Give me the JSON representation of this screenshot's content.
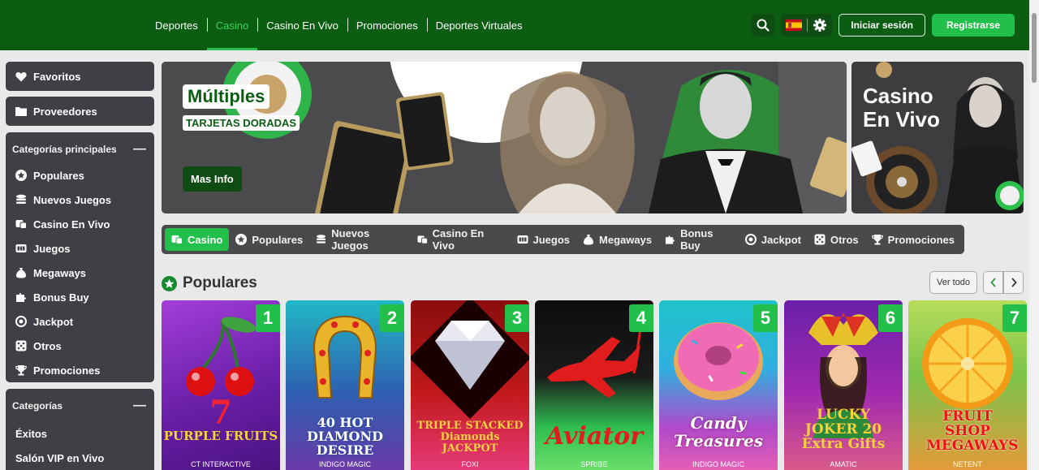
{
  "header": {
    "nav": [
      "Deportes",
      "Casino",
      "Casino En Vivo",
      "Promociones",
      "Deportes Virtuales"
    ],
    "active_nav": "Casino",
    "login_label": "Iniciar sesión",
    "register_label": "Registrarse"
  },
  "sidebar": {
    "favorites_label": "Favoritos",
    "providers_label": "Proveedores",
    "main_categories_title": "Categorías principales",
    "main_categories": [
      "Populares",
      "Nuevos Juegos",
      "Casino En Vivo",
      "Juegos",
      "Megaways",
      "Bonus Buy",
      "Jackpot",
      "Otros",
      "Promociones"
    ],
    "categories_title": "Categorías",
    "categories": [
      "Éxitos",
      "Salón VIP en Vivo"
    ]
  },
  "banner": {
    "title": "Múltiples",
    "subtitle": "TARJETAS DORADAS",
    "cta": "Mas Info",
    "side_title_1": "Casino",
    "side_title_2": "En Vivo"
  },
  "category_bar": [
    "Casino",
    "Populares",
    "Nuevos Juegos",
    "Casino En Vivo",
    "Juegos",
    "Megaways",
    "Bonus Buy",
    "Jackpot",
    "Otros",
    "Promociones"
  ],
  "section": {
    "title": "Populares",
    "view_all": "Ver todo"
  },
  "games": [
    {
      "rank": "1",
      "name": "PURPLE FRUITS",
      "provider": "CT INTERACTIVE"
    },
    {
      "rank": "2",
      "name": "40 HOT DIAMOND DESIRE",
      "provider": "INDIGO MAGIC"
    },
    {
      "rank": "3",
      "name": "TRIPLE STACKED Diamonds JACKPOT",
      "provider": "FOXI"
    },
    {
      "rank": "4",
      "name": "Aviator",
      "provider": "SPRIBE"
    },
    {
      "rank": "5",
      "name": "Candy Treasures",
      "provider": "INDIGO MAGIC"
    },
    {
      "rank": "6",
      "name": "LUCKY JOKER 20 Extra Gifts",
      "provider": "AMATIC"
    },
    {
      "rank": "7",
      "name": "FRUIT SHOP MEGAWAYS",
      "provider": "NETENT"
    }
  ],
  "colors": {
    "header_bg": "#0b5d12",
    "accent_green": "#22c04a",
    "sidebar_bg": "#3f3f45"
  }
}
